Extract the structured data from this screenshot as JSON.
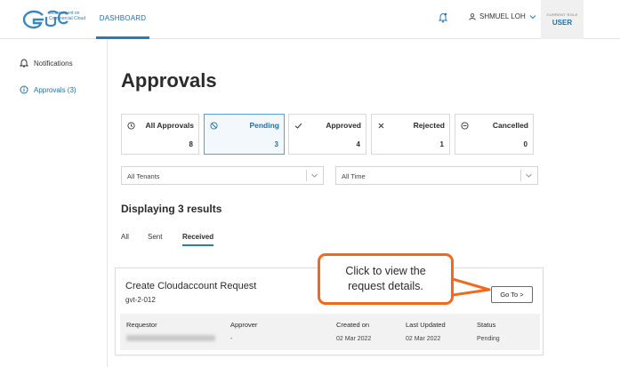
{
  "header": {
    "logo_text": "Government on Commercial Cloud",
    "nav_dashboard": "DASHBOARD",
    "user_name": "SHMUEL LOH",
    "role_caption": "CURRENT ROLE",
    "role_value": "USER"
  },
  "sidebar": {
    "items": [
      {
        "label": "Notifications",
        "icon": "bell-icon"
      },
      {
        "label": "Approvals (3)",
        "icon": "info-circle-icon"
      }
    ]
  },
  "main": {
    "title": "Approvals",
    "stats": [
      {
        "label": "All Approvals",
        "count": "8",
        "icon": "clock-icon"
      },
      {
        "label": "Pending",
        "count": "3",
        "icon": "ban-icon"
      },
      {
        "label": "Approved",
        "count": "4",
        "icon": "check-icon"
      },
      {
        "label": "Rejected",
        "count": "1",
        "icon": "x-icon"
      },
      {
        "label": "Cancelled",
        "count": "0",
        "icon": "minus-circle-icon"
      }
    ],
    "filters": {
      "tenant": "All Tenants",
      "time": "All Time"
    },
    "results_text": "Displaying 3 results",
    "tabs": [
      {
        "label": "All"
      },
      {
        "label": "Sent"
      },
      {
        "label": "Received"
      }
    ],
    "request": {
      "title": "Create Cloudaccount Request",
      "id": "gvt-2-012",
      "goto_label": "Go To >",
      "columns": {
        "requestor": "Requestor",
        "approver": "Approver",
        "created_on": "Created on",
        "last_updated": "Last Updated",
        "status": "Status"
      },
      "values": {
        "approver": "-",
        "created_on": "02 Mar 2022",
        "last_updated": "02 Mar 2022",
        "status": "Pending"
      }
    }
  },
  "callout": {
    "text": "Click to view the request details.",
    "color": "#ef6a1f"
  },
  "colors": {
    "accent": "#2a7ab8",
    "active_card_border": "#5aa0d2"
  }
}
